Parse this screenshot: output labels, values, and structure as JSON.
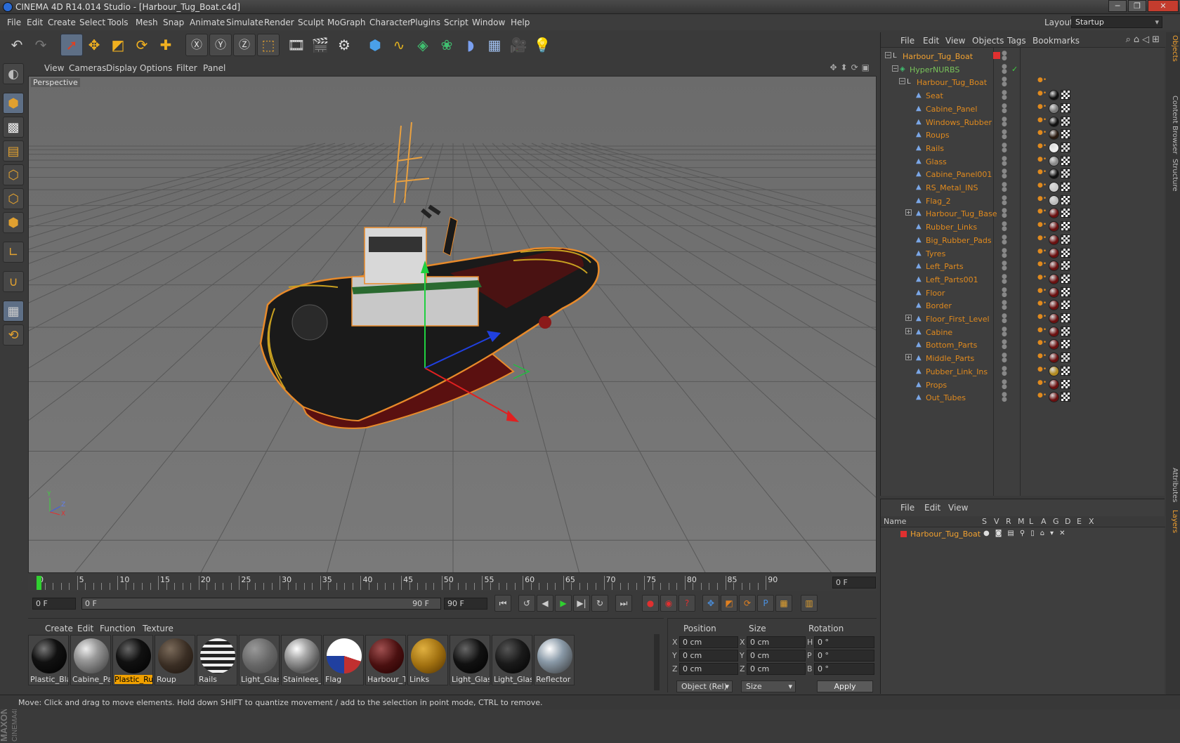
{
  "window": {
    "title": "CINEMA 4D R14.014 Studio - [Harbour_Tug_Boat.c4d]"
  },
  "menubar": [
    "File",
    "Edit",
    "Create",
    "Select",
    "Tools",
    "Mesh",
    "Snap",
    "Animate",
    "Simulate",
    "Render",
    "Sculpt",
    "MoGraph",
    "Character",
    "Plugins",
    "Script",
    "Window",
    "Help"
  ],
  "layout": {
    "label": "Layout:",
    "value": "Startup"
  },
  "viewport": {
    "menu": [
      "View",
      "Cameras",
      "Display",
      "Options",
      "Filter",
      "Panel"
    ],
    "label": "Perspective",
    "axis_labels": {
      "y": "Y",
      "z": "Z",
      "x": "X"
    }
  },
  "timeline": {
    "ticks": [
      "0",
      "5",
      "10",
      "15",
      "20",
      "25",
      "30",
      "35",
      "40",
      "45",
      "50",
      "55",
      "60",
      "65",
      "70",
      "75",
      "80",
      "85",
      "90"
    ],
    "current_frame": "0 F",
    "start_field": "0 F",
    "range_start": "0 F",
    "range_end": "90 F",
    "end_field": "90 F"
  },
  "materials": {
    "menu": [
      "Create",
      "Edit",
      "Function",
      "Texture"
    ],
    "items": [
      {
        "name": "Plastic_Blac",
        "selected": false
      },
      {
        "name": "Cabine_Par",
        "selected": false
      },
      {
        "name": "Plastic_Rub",
        "selected": true
      },
      {
        "name": "Roup",
        "selected": false
      },
      {
        "name": "Rails",
        "selected": false
      },
      {
        "name": "Light_Glass",
        "selected": false
      },
      {
        "name": "Stainlees_S",
        "selected": false
      },
      {
        "name": "Flag",
        "selected": false
      },
      {
        "name": "Harbour_Tu",
        "selected": false
      },
      {
        "name": "Links",
        "selected": false
      },
      {
        "name": "Light_Glass",
        "selected": false
      },
      {
        "name": "Light_Glass",
        "selected": false
      },
      {
        "name": "Reflector",
        "selected": false
      }
    ]
  },
  "coords": {
    "headers": {
      "position": "Position",
      "size": "Size",
      "rotation": "Rotation"
    },
    "rows": [
      {
        "pos_axis": "X",
        "pos": "0 cm",
        "size_axis": "X",
        "size": "0 cm",
        "rot_axis": "H",
        "rot": "0 °"
      },
      {
        "pos_axis": "Y",
        "pos": "0 cm",
        "size_axis": "Y",
        "size": "0 cm",
        "rot_axis": "P",
        "rot": "0 °"
      },
      {
        "pos_axis": "Z",
        "pos": "0 cm",
        "size_axis": "Z",
        "size": "0 cm",
        "rot_axis": "B",
        "rot": "0 °"
      }
    ],
    "mode_dropdown": "Object (Rel)",
    "size_dropdown": "Size",
    "apply_label": "Apply"
  },
  "object_manager": {
    "menu": [
      "File",
      "Edit",
      "View",
      "Objects",
      "Tags",
      "Bookmarks"
    ],
    "objects": [
      {
        "name": "Harbour_Tug_Boat",
        "depth": 0,
        "kind": "null",
        "expand": "minus"
      },
      {
        "name": "HyperNURBS",
        "depth": 1,
        "kind": "hyper",
        "expand": "minus"
      },
      {
        "name": "Harbour_Tug_Boat",
        "depth": 2,
        "kind": "null",
        "expand": "minus"
      },
      {
        "name": "Seat",
        "depth": 3,
        "kind": "poly",
        "expand": ""
      },
      {
        "name": "Cabine_Panel",
        "depth": 3,
        "kind": "poly",
        "expand": ""
      },
      {
        "name": "Windows_Rubber",
        "depth": 3,
        "kind": "poly",
        "expand": ""
      },
      {
        "name": "Roups",
        "depth": 3,
        "kind": "poly",
        "expand": ""
      },
      {
        "name": "Rails",
        "depth": 3,
        "kind": "poly",
        "expand": ""
      },
      {
        "name": "Glass",
        "depth": 3,
        "kind": "poly",
        "expand": ""
      },
      {
        "name": "Cabine_Panel001",
        "depth": 3,
        "kind": "poly",
        "expand": ""
      },
      {
        "name": "RS_Metal_INS",
        "depth": 3,
        "kind": "poly",
        "expand": ""
      },
      {
        "name": "Flag_2",
        "depth": 3,
        "kind": "poly",
        "expand": ""
      },
      {
        "name": "Harbour_Tug_Base",
        "depth": 3,
        "kind": "poly",
        "expand": "plus"
      },
      {
        "name": "Rubber_Links",
        "depth": 3,
        "kind": "poly",
        "expand": ""
      },
      {
        "name": "Big_Rubber_Pads",
        "depth": 3,
        "kind": "poly",
        "expand": ""
      },
      {
        "name": "Tyres",
        "depth": 3,
        "kind": "poly",
        "expand": ""
      },
      {
        "name": "Left_Parts",
        "depth": 3,
        "kind": "poly",
        "expand": ""
      },
      {
        "name": "Left_Parts001",
        "depth": 3,
        "kind": "poly",
        "expand": ""
      },
      {
        "name": "Floor",
        "depth": 3,
        "kind": "poly",
        "expand": ""
      },
      {
        "name": "Border",
        "depth": 3,
        "kind": "poly",
        "expand": ""
      },
      {
        "name": "Floor_First_Level",
        "depth": 3,
        "kind": "poly",
        "expand": "plus"
      },
      {
        "name": "Cabine",
        "depth": 3,
        "kind": "poly",
        "expand": "plus"
      },
      {
        "name": "Bottom_Parts",
        "depth": 3,
        "kind": "poly",
        "expand": ""
      },
      {
        "name": "Middle_Parts",
        "depth": 3,
        "kind": "poly",
        "expand": "plus"
      },
      {
        "name": "Pubber_Link_Ins",
        "depth": 3,
        "kind": "poly",
        "expand": ""
      },
      {
        "name": "Props",
        "depth": 3,
        "kind": "poly",
        "expand": ""
      },
      {
        "name": "Out_Tubes",
        "depth": 3,
        "kind": "poly",
        "expand": ""
      }
    ]
  },
  "side_tabs": [
    "Objects",
    "Content Browser",
    "Structure",
    "Attributes",
    "Layers"
  ],
  "layer_manager": {
    "menu": [
      "File",
      "Edit",
      "View"
    ],
    "columns": [
      "Name",
      "S",
      "V",
      "R",
      "M",
      "L",
      "A",
      "G",
      "D",
      "E",
      "X"
    ],
    "layers": [
      {
        "name": "Harbour_Tug_Boat",
        "color": "#e03030"
      }
    ]
  },
  "status": "Move: Click and drag to move elements. Hold down SHIFT to quantize movement / add to the selection in point mode, CTRL to remove.",
  "colors": {
    "accent": "#f0a000",
    "selection": "#5e6f86",
    "object_text": "#e08a1e",
    "hyper_text": "#79c35a"
  }
}
